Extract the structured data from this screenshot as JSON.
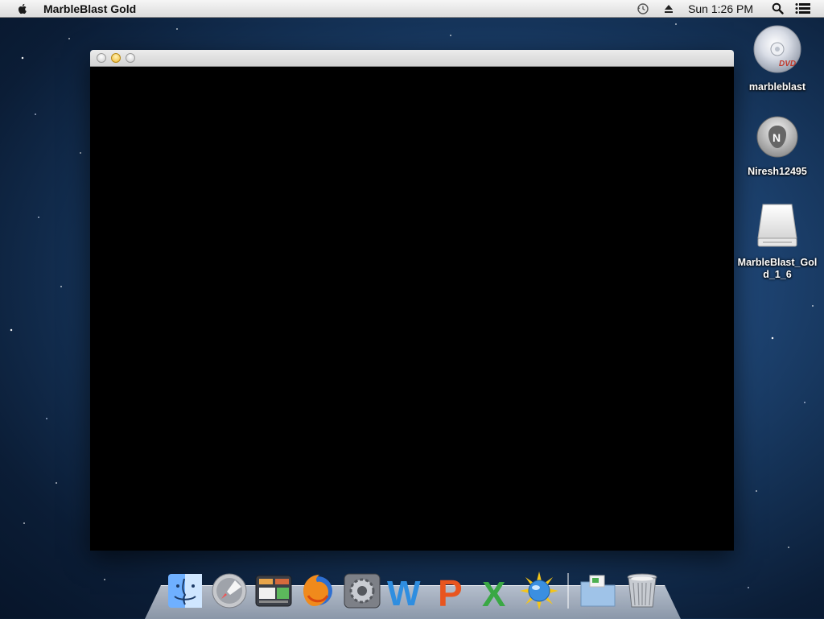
{
  "menubar": {
    "app_name": "MarbleBlast Gold",
    "clock": "Sun 1:26 PM",
    "icons": [
      "apple-icon",
      "time-machine-icon",
      "eject-icon",
      "spotlight-icon",
      "notification-center-icon"
    ]
  },
  "window": {
    "title": "",
    "controls": [
      "close-button",
      "minimize-button",
      "zoom-button"
    ]
  },
  "desktop_icons": [
    {
      "label": "marbleblast",
      "icon": "dvd-icon"
    },
    {
      "label": "Niresh12495",
      "icon": "boot-disk-icon"
    },
    {
      "label": "MarbleBlast_Gold_1_6",
      "icon": "external-drive-icon"
    }
  ],
  "dock": {
    "apps": [
      {
        "name": "Finder",
        "icon": "finder-icon"
      },
      {
        "name": "Launchpad",
        "icon": "launchpad-icon"
      },
      {
        "name": "Mission Control",
        "icon": "mission-control-icon"
      },
      {
        "name": "Firefox",
        "icon": "firefox-icon"
      },
      {
        "name": "System Preferences",
        "icon": "system-preferences-icon"
      },
      {
        "name": "Word",
        "icon": "word-icon"
      },
      {
        "name": "PowerPoint",
        "icon": "powerpoint-icon"
      },
      {
        "name": "Excel",
        "icon": "excel-icon"
      },
      {
        "name": "Network Utility",
        "icon": "network-globe-icon"
      },
      {
        "name": "Downloads",
        "icon": "downloads-folder-icon"
      },
      {
        "name": "Trash",
        "icon": "trash-icon"
      }
    ]
  },
  "colors": {
    "desktop_top": "#214a7c",
    "desktop_edge": "#07152a",
    "menubar": "#e8e8e8",
    "window_content": "#000000",
    "minimize_yellow": "#f0b630"
  }
}
